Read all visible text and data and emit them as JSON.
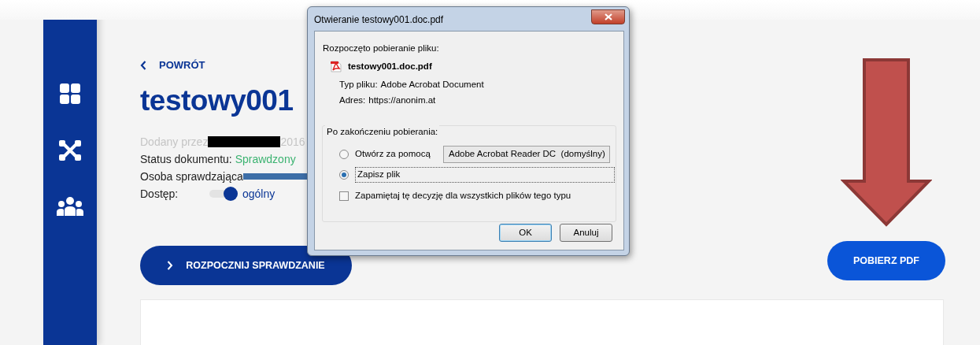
{
  "page": {
    "back_link": "POWRÓT",
    "title": "testowy001",
    "meta": {
      "added_by_label": "Dodany przez",
      "added_date": "2016",
      "status_label": "Status dokumentu:",
      "status_value": "Sprawdzony",
      "checker_label": "Osoba sprawdzająca",
      "access_label": "Dostęp:",
      "access_on": true,
      "access_value": "ogólny"
    },
    "start_button": "ROZPOCZNIJ SPRAWDZANIE",
    "download_button": "POBIERZ PDF"
  },
  "dialog": {
    "title": "Otwieranie testowy001.doc.pdf",
    "heading": "Rozpoczęto pobieranie pliku:",
    "file_name": "testowy001.doc.pdf",
    "fields": [
      {
        "label": "Typ pliku:",
        "value": "Adobe Acrobat Document"
      },
      {
        "label": "Adres:",
        "value": "https://anonim.at"
      }
    ],
    "group_title": "Po zakończeniu pobierania:",
    "options": [
      {
        "label": "Otwórz za pomocą",
        "selected": false,
        "app": "Adobe Acrobat Reader DC  (domyślny)"
      },
      {
        "label": "Zapisz plik",
        "selected": true
      }
    ],
    "remember": {
      "label": "Zapamiętaj tę decyzję dla wszystkich plików tego typu",
      "checked": false
    },
    "buttons": [
      {
        "label": "OK",
        "default": true
      },
      {
        "label": "Anuluj",
        "default": false
      }
    ]
  }
}
